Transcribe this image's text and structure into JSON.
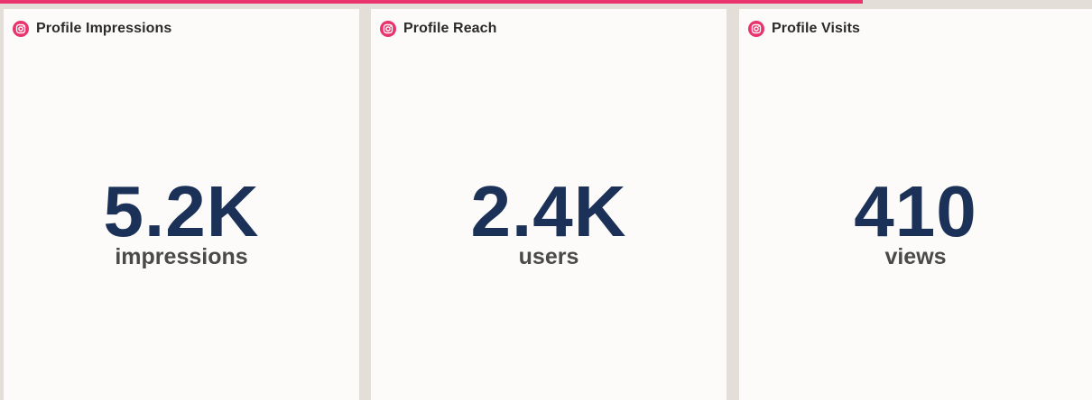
{
  "colors": {
    "accent": "#e8336d",
    "value_text": "#1b3158",
    "unit_text": "#4a4a4a",
    "card_background": "#fcfbf9",
    "page_background": "#e3ded8"
  },
  "progress": {
    "fraction": 0.79
  },
  "cards": [
    {
      "icon": "instagram-icon",
      "title": "Profile Impressions",
      "value": "5.2K",
      "unit": "impressions"
    },
    {
      "icon": "instagram-icon",
      "title": "Profile Reach",
      "value": "2.4K",
      "unit": "users"
    },
    {
      "icon": "instagram-icon",
      "title": "Profile Visits",
      "value": "410",
      "unit": "views"
    }
  ]
}
